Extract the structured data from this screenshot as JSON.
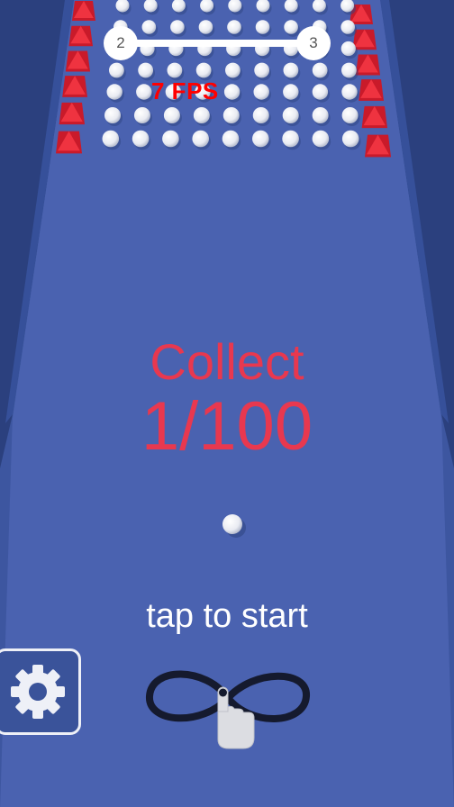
{
  "hud": {
    "level_current": "2",
    "level_next": "3",
    "fps": "7 FPS"
  },
  "game": {
    "collect_label": "Collect",
    "collect_count": "1/100",
    "tap_hint": "tap to start"
  },
  "icons": {
    "settings": "gear-icon",
    "gesture": "infinity-swipe-icon",
    "hand": "pointing-hand-icon"
  },
  "colors": {
    "floor": "#4a62b0",
    "wall": "#2a3f7a",
    "accent_red": "#e8384f",
    "obstacle_red": "#e82232",
    "fps_red": "#ff0000"
  }
}
